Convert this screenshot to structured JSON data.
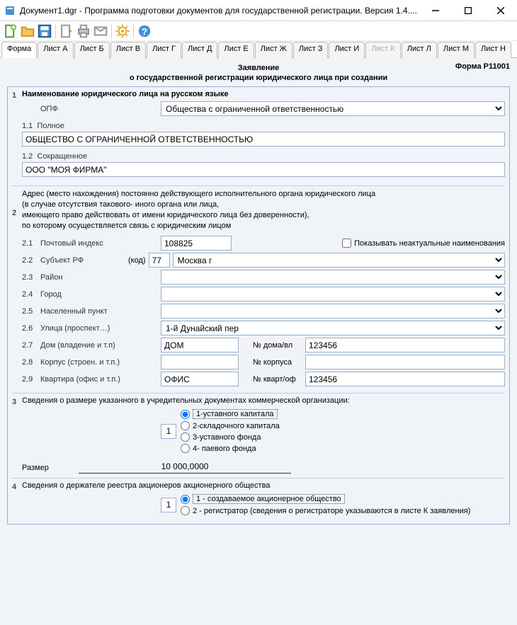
{
  "window": {
    "title": "Документ1.dgr - Программа подготовки документов для государственной регистрации. Версия 1.4...."
  },
  "tabs": {
    "items": [
      "Форма",
      "Лист А",
      "Лист Б",
      "Лист В",
      "Лист Г",
      "Лист Д",
      "Лист Е",
      "Лист Ж",
      "Лист З",
      "Лист И",
      "Лист К",
      "Лист Л",
      "Лист М",
      "Лист Н"
    ],
    "active": 0,
    "disabled": [
      10
    ]
  },
  "header": {
    "line1": "Заявление",
    "line2": "о государственной регистрации юридического лица при создании",
    "form_code": "Форма Р11001"
  },
  "sec1": {
    "title": "Наименование юридического лица на русском языке",
    "opf_label": "ОПФ",
    "opf_value": "Общества с ограниченной ответственностью",
    "full_num": "1.1",
    "full_label": "Полное",
    "full_value": "ОБЩЕСТВО С ОГРАНИЧЕННОЙ ОТВЕТСТВЕННОСТЬЮ",
    "short_num": "1.2",
    "short_label": "Сокращенное",
    "short_value": "ООО \"МОЯ ФИРМА\""
  },
  "sec2": {
    "para": "Адрес (место нахождения) постоянно действующего исполнительного органа юридического лица\n(в случае отсутствия такового- иного органа или лица,\nимеющего право действовать от имени юридического лица без доверенности),\nпо которому осуществляется связь с юридическим лицом",
    "show_obsolete": "Показывать неактуальные наименования",
    "r21_num": "2.1",
    "r21_label": "Почтовый индекс",
    "r21_value": "108825",
    "r22_num": "2.2",
    "r22_label": "Субъект РФ",
    "r22_code_label": "(код)",
    "r22_code": "77",
    "r22_value": "Москва г",
    "r23_num": "2.3",
    "r23_label": "Район",
    "r24_num": "2.4",
    "r24_label": "Город",
    "r25_num": "2.5",
    "r25_label": "Населенный пункт",
    "r26_num": "2.6",
    "r26_label": "Улица (проспект…)",
    "r26_value": "1-й Дунайский пер",
    "r27_num": "2.7",
    "r27_label": "Дом (владение и т.п)",
    "r27_type": "ДОМ",
    "r27_num_label": "№ дома/вл",
    "r27_value": "123456",
    "r28_num": "2.8",
    "r28_label": "Корпус (строен. и т.п.)",
    "r28_num_label": "№ корпуса",
    "r29_num": "2.9",
    "r29_label": "Квартира (офис и т.п.)",
    "r29_type": "ОФИС",
    "r29_num_label": "№ кварт/оф",
    "r29_value": "123456"
  },
  "sec3": {
    "title": "Сведения о размере указанного в учредительных документах коммерческой организации:",
    "box_value": "1",
    "options": [
      "1-уставного капитала",
      "2-складочного капитала",
      "3-уставного фонда",
      "4- паевого фонда"
    ],
    "selected": 0,
    "size_label": "Размер",
    "size_value": "10 000,0000"
  },
  "sec4": {
    "title": "Сведения о держателе реестра акционеров акционерного общества",
    "box_value": "1",
    "options": [
      "1 - создаваемое акционерное общество",
      "2 - регистратор (сведения о регистраторе указываются в листе К заявления)"
    ],
    "selected": 0
  }
}
